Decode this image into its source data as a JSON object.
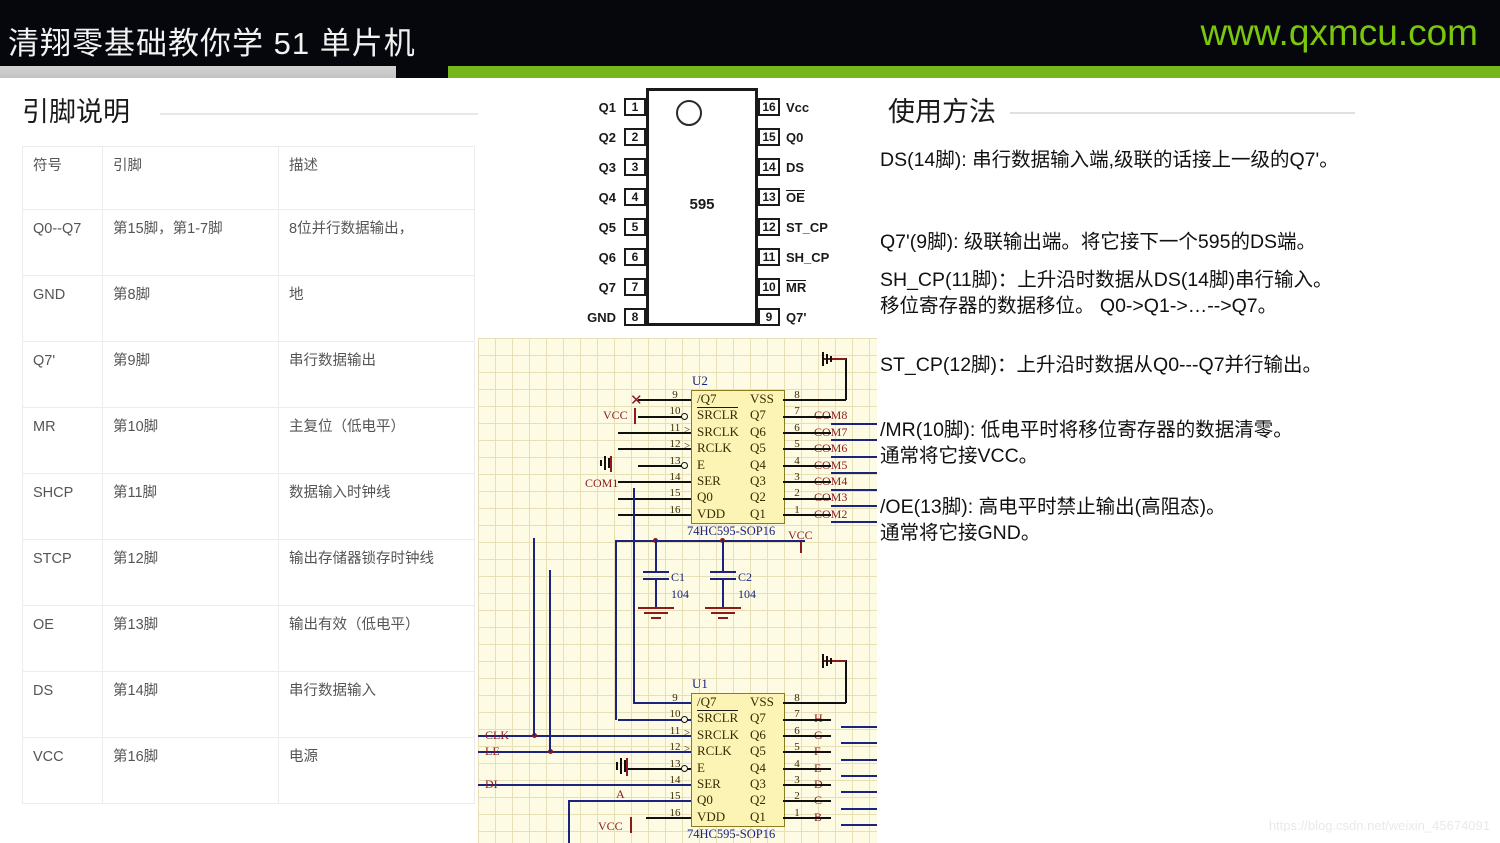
{
  "header": {
    "title": "清翔零基础教你学 51 单片机",
    "site": "www.qxmcu.com",
    "accent_green": "#76b71b",
    "bg": "#05070c"
  },
  "left_panel": {
    "title": "引脚说明",
    "table": {
      "headers": [
        "符号",
        "引脚",
        "描述"
      ],
      "rows": [
        {
          "symbol": "Q0--Q7",
          "pin": "第15脚，第1-7脚",
          "desc": "8位并行数据输出，"
        },
        {
          "symbol": "GND",
          "pin": "第8脚",
          "desc": "地"
        },
        {
          "symbol": "Q7'",
          "pin": "第9脚",
          "desc": "串行数据输出"
        },
        {
          "symbol": "MR",
          "pin": "第10脚",
          "desc": "主复位（低电平）"
        },
        {
          "symbol": "SHCP",
          "pin": "第11脚",
          "desc": "数据输入时钟线"
        },
        {
          "symbol": "STCP",
          "pin": "第12脚",
          "desc": "输出存储器锁存时钟线"
        },
        {
          "symbol": "OE",
          "pin": "第13脚",
          "desc": "输出有效（低电平）"
        },
        {
          "symbol": "DS",
          "pin": "第14脚",
          "desc": "串行数据输入"
        },
        {
          "symbol": "VCC",
          "pin": "第16脚",
          "desc": "电源"
        }
      ]
    }
  },
  "pinout": {
    "chip_label": "595",
    "left_pins": [
      {
        "num": "1",
        "name": "Q1"
      },
      {
        "num": "2",
        "name": "Q2"
      },
      {
        "num": "3",
        "name": "Q3"
      },
      {
        "num": "4",
        "name": "Q4"
      },
      {
        "num": "5",
        "name": "Q5"
      },
      {
        "num": "6",
        "name": "Q6"
      },
      {
        "num": "7",
        "name": "Q7"
      },
      {
        "num": "8",
        "name": "GND"
      }
    ],
    "right_pins": [
      {
        "num": "16",
        "name": "Vcc",
        "overline": false
      },
      {
        "num": "15",
        "name": "Q0",
        "overline": false
      },
      {
        "num": "14",
        "name": "DS",
        "overline": false
      },
      {
        "num": "13",
        "name": "OE",
        "overline": true
      },
      {
        "num": "12",
        "name": "ST_CP",
        "overline": false
      },
      {
        "num": "11",
        "name": "SH_CP",
        "overline": false
      },
      {
        "num": "10",
        "name": "MR",
        "overline": true
      },
      {
        "num": "9",
        "name": "Q7'",
        "overline": false
      }
    ]
  },
  "schematic": {
    "u2": {
      "ref": "U2",
      "part": "74HC595-SOP16",
      "left_pin_numbers": [
        "9",
        "10",
        "11",
        "12",
        "13",
        "14",
        "15",
        "16"
      ],
      "left_pin_names": [
        "/Q7",
        "SRCLR",
        "SRCLK",
        "RCLK",
        "E",
        "SER",
        "Q0",
        "VDD"
      ],
      "right_pin_numbers": [
        "8",
        "7",
        "6",
        "5",
        "4",
        "3",
        "2",
        "1"
      ],
      "right_pin_names": [
        "VSS",
        "Q7",
        "Q6",
        "Q5",
        "Q4",
        "Q3",
        "Q2",
        "Q1"
      ],
      "right_nets": [
        "",
        "COM8",
        "COM7",
        "COM6",
        "COM5",
        "COM4",
        "COM3",
        "COM2"
      ],
      "left_nets": [
        "VCC",
        "COM1",
        "VCC"
      ]
    },
    "u1": {
      "ref": "U1",
      "part": "74HC595-SOP16",
      "left_pin_numbers": [
        "9",
        "10",
        "11",
        "12",
        "13",
        "14",
        "15",
        "16"
      ],
      "left_pin_names": [
        "/Q7",
        "SRCLR",
        "SRCLK",
        "RCLK",
        "E",
        "SER",
        "Q0",
        "VDD"
      ],
      "right_pin_numbers": [
        "8",
        "7",
        "6",
        "5",
        "4",
        "3",
        "2",
        "1"
      ],
      "right_pin_names": [
        "VSS",
        "Q7",
        "Q6",
        "Q5",
        "Q4",
        "Q3",
        "Q2",
        "Q1"
      ],
      "right_nets": [
        "",
        "H",
        "G",
        "F",
        "E",
        "D",
        "C",
        "B"
      ],
      "left_nets": [
        "CLK",
        "LE",
        "DI",
        "A",
        "VCC"
      ]
    },
    "capacitors": [
      {
        "ref": "C1",
        "value": "104"
      },
      {
        "ref": "C2",
        "value": "104"
      }
    ]
  },
  "right_panel": {
    "title": "使用方法",
    "items": [
      "DS(14脚): 串行数据输入端,级联的话接上一级的Q7'。",
      "Q7'(9脚): 级联输出端。将它接下一个595的DS端。",
      "SH_CP(11脚)：上升沿时数据从DS(14脚)串行输入。\n移位寄存器的数据移位。 Q0->Q1->…-->Q7。",
      "ST_CP(12脚)：上升沿时数据从Q0---Q7并行输出。",
      "/MR(10脚): 低电平时将移位寄存器的数据清零。\n通常将它接VCC。",
      "/OE(13脚): 高电平时禁止输出(高阻态)。\n通常将它接GND。"
    ]
  },
  "watermark": "https://blog.csdn.net/weixin_45674091"
}
